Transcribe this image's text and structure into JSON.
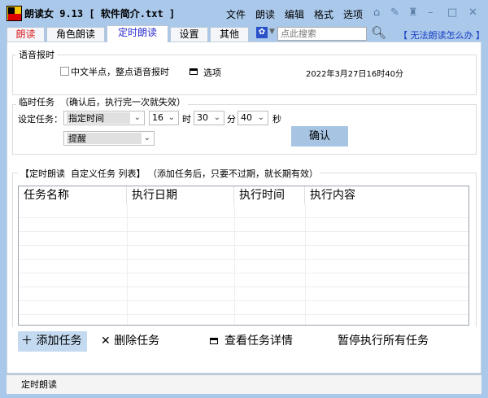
{
  "window": {
    "title": "朗读女 9.13 [ 软件简介.txt ]"
  },
  "menu": [
    "文件",
    "朗读",
    "编辑",
    "格式",
    "选项"
  ],
  "tabs": [
    "朗读",
    "角色朗读",
    "定时朗读",
    "设置",
    "其他"
  ],
  "search": {
    "placeholder": "点此搜索"
  },
  "help_link": "【 无法朗读怎么办 】",
  "voice_clock": {
    "label": "语音报时",
    "checkbox_label": "中文半点，整点语音报时",
    "checked": false,
    "options_label": "选项",
    "datetime": "2022年3月27日16时40分"
  },
  "temp_task": {
    "label": "临时任务  （确认后，执行完一次就失效）",
    "set_label": "设定任务：",
    "mode": "指定时间",
    "hour": "16",
    "hour_unit": "时",
    "minute": "30",
    "minute_unit": "分",
    "second": "40",
    "second_unit": "秒",
    "action": "提醒",
    "confirm": "确认"
  },
  "task_list": {
    "label": "【定时朗读  自定义任务 列表】 （添加任务后，只要不过期，就长期有效）",
    "columns": [
      "任务名称",
      "执行日期",
      "执行时间",
      "执行内容"
    ],
    "rows": []
  },
  "actions": {
    "add": "添加任务",
    "delete": "删除任务",
    "view": "查看任务详情",
    "pause": "暂停执行所有任务"
  },
  "status": "定时朗读"
}
